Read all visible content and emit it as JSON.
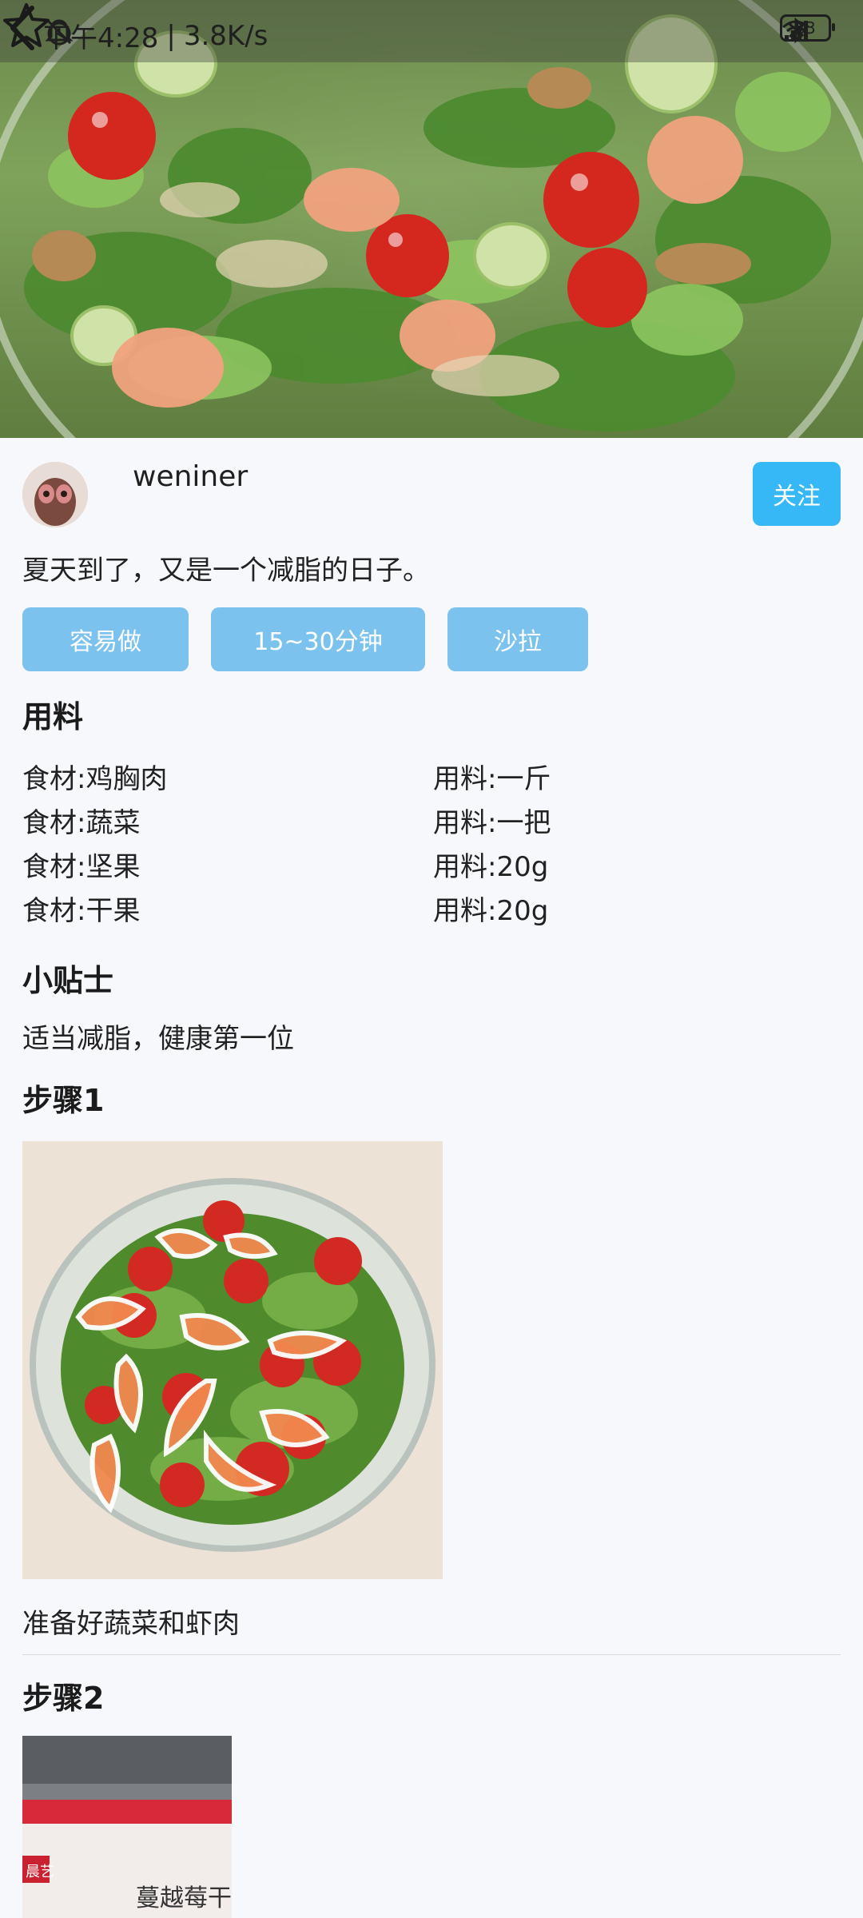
{
  "status_bar": {
    "time": "下午4:28",
    "separator": "|",
    "network_speed": "3.8K/s",
    "battery": "83",
    "icons": [
      "mute-bell-icon",
      "alarm-icon",
      "bluetooth-icon",
      "hd-signal-icon",
      "wifi-icon",
      "battery-icon"
    ]
  },
  "header": {
    "back_icon": "chevron-left-icon",
    "favorite_icon": "star-outline-icon"
  },
  "author": {
    "name": "weniner",
    "follow_label": "关注"
  },
  "intro": "夏天到了，又是一个减脂的日子。",
  "tags": [
    "容易做",
    "15~30分钟",
    "沙拉"
  ],
  "ingredients": {
    "title": "用料",
    "items": [
      {
        "food": "食材:鸡胸肉",
        "amount": "用料:一斤"
      },
      {
        "food": "食材:蔬菜",
        "amount": "用料:一把"
      },
      {
        "food": "食材:坚果",
        "amount": "用料:20g"
      },
      {
        "food": "食材:干果",
        "amount": "用料:20g"
      }
    ]
  },
  "tips": {
    "title": "小贴士",
    "text": "适当减脂，健康第一位"
  },
  "steps": [
    {
      "title": "步骤1",
      "caption": "准备好蔬菜和虾肉"
    },
    {
      "title": "步骤2",
      "caption": ""
    }
  ],
  "step2_package_text": "蔓越莓干",
  "step2_package_logo": "晨艺",
  "colors": {
    "follow_button": "#35b8f5",
    "tag": "#7cc2ee",
    "background": "#f7f8fc"
  }
}
